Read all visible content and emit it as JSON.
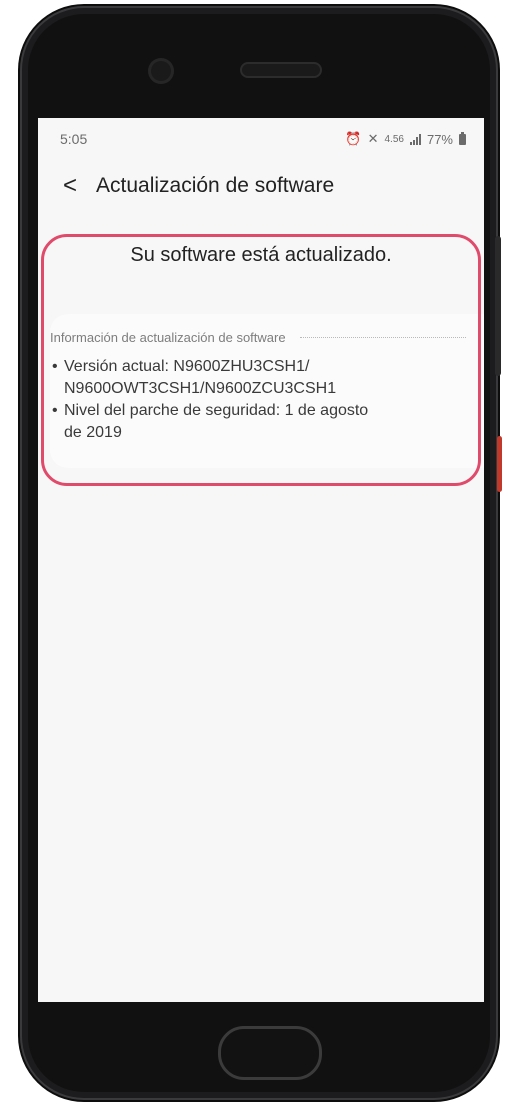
{
  "status_bar": {
    "time": "5:05",
    "network_speed": "4.56",
    "battery_percent": "77%",
    "icons": [
      "alarm-icon",
      "mute-icon",
      "lte-icon",
      "signal-icon",
      "battery-icon"
    ]
  },
  "header": {
    "back_label": "<",
    "title": "Actualización de software"
  },
  "main": {
    "status_message": "Su software está actualizado.",
    "info": {
      "heading": "Información de actualización de software",
      "version_line1": "Versión actual: N9600ZHU3CSH1/",
      "version_line2": "N9600OWT3CSH1/N9600ZCU3CSH1",
      "patch_line1": "Nivel del parche de seguridad: 1 de agosto",
      "patch_line2": "de 2019"
    }
  },
  "colors": {
    "highlight_border": "#e04b6b",
    "screen_background": "#f7f7f7",
    "phone_body": "#1c1c1e"
  }
}
